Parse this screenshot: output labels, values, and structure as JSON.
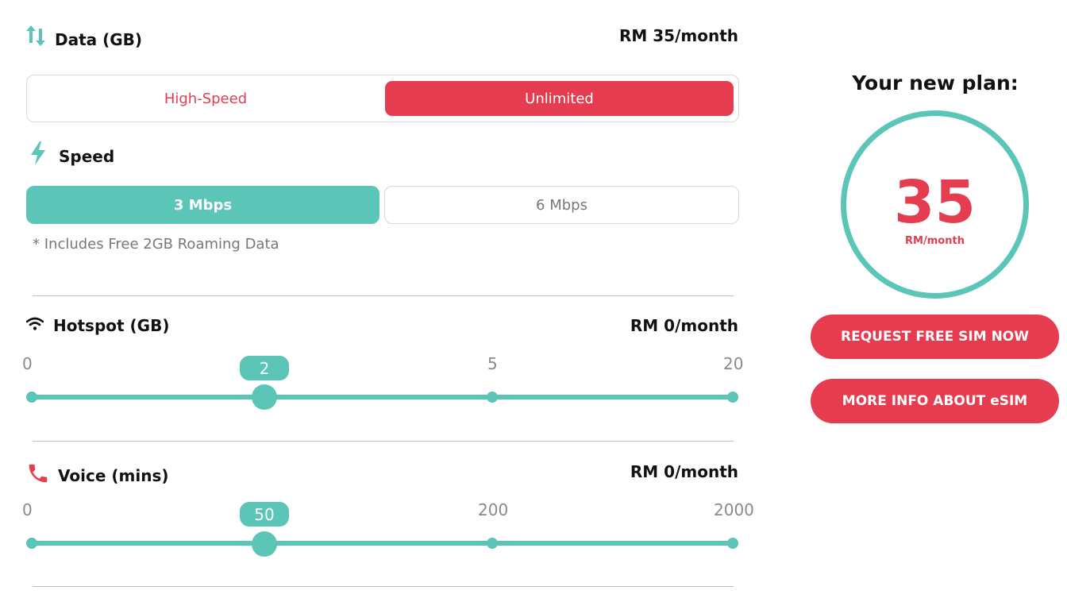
{
  "data_section": {
    "title": "Data (GB)",
    "price": "RM 35/month",
    "options": [
      {
        "label": "High-Speed",
        "selected": false
      },
      {
        "label": "Unlimited",
        "selected": true
      }
    ]
  },
  "speed_section": {
    "title": "Speed",
    "options": [
      {
        "label": "3 Mbps",
        "selected": true
      },
      {
        "label": "6 Mbps",
        "selected": false
      }
    ],
    "note": "* Includes Free 2GB Roaming Data"
  },
  "hotspot_section": {
    "title": "Hotspot (GB)",
    "price": "RM 0/month",
    "ticks": [
      "0",
      "5",
      "20"
    ],
    "value": "2"
  },
  "voice_section": {
    "title": "Voice (mins)",
    "price": "RM 0/month",
    "ticks": [
      "0",
      "200",
      "2000"
    ],
    "value": "50"
  },
  "plan_panel": {
    "title": "Your new plan:",
    "price": "35",
    "unit": "RM/month",
    "buttons": {
      "request_sim": "REQUEST FREE SIM NOW",
      "more_info": "MORE INFO ABOUT eSIM"
    }
  },
  "colors": {
    "accent_red": "#e63c50",
    "accent_teal": "#5bc5b8"
  }
}
